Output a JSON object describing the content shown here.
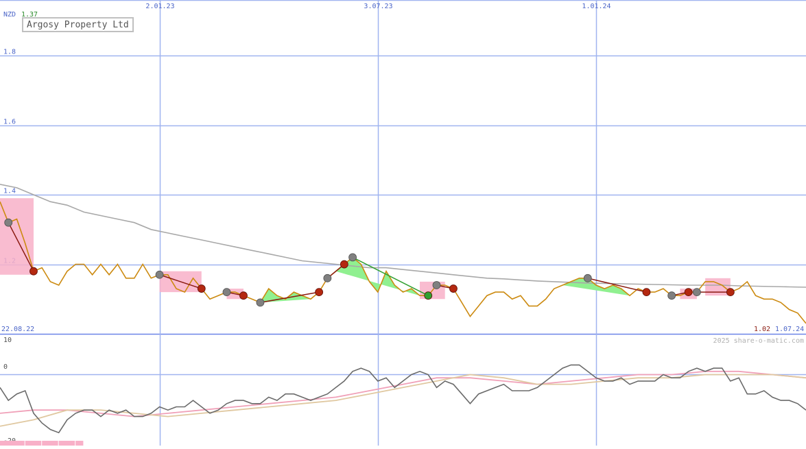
{
  "chart_data": [
    {
      "type": "line",
      "currency": "NZD",
      "last_price": "1.37",
      "title": "Argosy Property Ltd",
      "start_date": "22.08.22",
      "end_date": "1.07.24",
      "last_value_label": "1.02",
      "credit": "2025 share-o-matic.com",
      "x_ticks": [
        {
          "label": "2.01.23",
          "x": 19
        },
        {
          "label": "3.07.23",
          "x": 45
        },
        {
          "label": "1.01.24",
          "x": 71
        }
      ],
      "ylim": [
        1.0,
        1.96
      ],
      "y_ticks": [
        {
          "label": "1.8",
          "v": 1.8
        },
        {
          "label": "1.6",
          "v": 1.6
        },
        {
          "label": "1.4",
          "v": 1.4
        },
        {
          "label": "1.2",
          "v": 1.2
        }
      ],
      "grid": true,
      "xlim": [
        0,
        96
      ],
      "series": [
        {
          "color": "#cc8a10",
          "x": [
            0,
            1,
            2,
            3,
            4,
            5,
            6,
            7,
            8,
            9,
            10,
            11,
            12,
            13,
            14,
            15,
            16,
            17,
            18,
            19,
            20,
            21,
            22,
            23,
            24,
            25,
            26,
            27,
            28,
            29,
            30,
            31,
            32,
            33,
            34,
            35,
            36,
            37,
            38,
            39,
            40,
            41,
            42,
            43,
            44,
            45,
            46,
            47,
            48,
            49,
            50,
            51,
            52,
            53,
            54,
            55,
            56,
            57,
            58,
            59,
            60,
            61,
            62,
            63,
            64,
            65,
            66,
            67,
            68,
            69,
            70,
            71,
            72,
            73,
            74,
            75,
            76,
            77,
            78,
            79,
            80,
            81,
            82,
            83,
            84,
            85,
            86,
            87,
            88,
            89,
            90,
            91,
            92,
            93,
            94,
            95,
            96
          ],
          "y": [
            1.38,
            1.32,
            1.33,
            1.26,
            1.18,
            1.19,
            1.15,
            1.14,
            1.18,
            1.2,
            1.2,
            1.17,
            1.2,
            1.17,
            1.2,
            1.16,
            1.16,
            1.2,
            1.16,
            1.17,
            1.17,
            1.13,
            1.12,
            1.16,
            1.13,
            1.1,
            1.11,
            1.12,
            1.12,
            1.11,
            1.1,
            1.09,
            1.13,
            1.11,
            1.1,
            1.12,
            1.11,
            1.1,
            1.12,
            1.16,
            1.18,
            1.2,
            1.22,
            1.2,
            1.15,
            1.12,
            1.18,
            1.14,
            1.12,
            1.13,
            1.11,
            1.11,
            1.14,
            1.14,
            1.13,
            1.09,
            1.05,
            1.08,
            1.11,
            1.12,
            1.12,
            1.1,
            1.11,
            1.08,
            1.08,
            1.1,
            1.13,
            1.14,
            1.15,
            1.16,
            1.16,
            1.14,
            1.13,
            1.14,
            1.13,
            1.11,
            1.13,
            1.12,
            1.12,
            1.13,
            1.11,
            1.11,
            1.12,
            1.12,
            1.15,
            1.15,
            1.14,
            1.12,
            1.13,
            1.15,
            1.11,
            1.1,
            1.1,
            1.09,
            1.07,
            1.06,
            1.03
          ]
        },
        {
          "color": "#a8a8a8",
          "x": [
            0,
            2,
            4,
            6,
            8,
            10,
            12,
            14,
            16,
            18,
            20,
            22,
            24,
            26,
            28,
            30,
            32,
            34,
            36,
            38,
            40,
            42,
            44,
            46,
            48,
            50,
            52,
            54,
            56,
            58,
            60,
            62,
            64,
            66,
            68,
            70,
            72,
            74,
            76,
            78,
            80,
            82,
            84,
            86,
            88,
            90,
            92,
            94,
            96
          ],
          "y": [
            1.43,
            1.42,
            1.4,
            1.38,
            1.37,
            1.35,
            1.34,
            1.33,
            1.32,
            1.3,
            1.29,
            1.28,
            1.27,
            1.26,
            1.25,
            1.24,
            1.23,
            1.22,
            1.21,
            1.205,
            1.2,
            1.195,
            1.19,
            1.19,
            1.185,
            1.18,
            1.175,
            1.17,
            1.165,
            1.16,
            1.158,
            1.155,
            1.152,
            1.15,
            1.148,
            1.146,
            1.145,
            1.144,
            1.143,
            1.142,
            1.141,
            1.14,
            1.14,
            1.14,
            1.138,
            1.137,
            1.136,
            1.135,
            1.134
          ]
        }
      ]
    },
    {
      "type": "line",
      "ylim": [
        -22,
        12
      ],
      "y_ticks": [
        {
          "label": "10",
          "v": 10
        },
        {
          "label": "0",
          "v": 0
        },
        {
          "label": "-20",
          "v": -20
        }
      ],
      "series": [
        {
          "color": "#6a6a6a",
          "x": [
            0,
            1,
            2,
            3,
            4,
            5,
            6,
            7,
            8,
            9,
            10,
            11,
            12,
            13,
            14,
            15,
            16,
            17,
            18,
            19,
            20,
            21,
            22,
            23,
            24,
            25,
            26,
            27,
            28,
            29,
            30,
            31,
            32,
            33,
            34,
            35,
            36,
            37,
            38,
            39,
            40,
            41,
            42,
            43,
            44,
            45,
            46,
            47,
            48,
            49,
            50,
            51,
            52,
            53,
            54,
            55,
            56,
            57,
            58,
            59,
            60,
            61,
            62,
            63,
            64,
            65,
            66,
            67,
            68,
            69,
            70,
            71,
            72,
            73,
            74,
            75,
            76,
            77,
            78,
            79,
            80,
            81,
            82,
            83,
            84,
            85,
            86,
            87,
            88,
            89,
            90,
            91,
            92,
            93,
            94,
            95,
            96
          ],
          "y": [
            -4,
            -8,
            -6,
            -5,
            -12,
            -15,
            -17,
            -18,
            -14,
            -12,
            -11,
            -11,
            -13,
            -11,
            -12,
            -11,
            -13,
            -13,
            -12,
            -10,
            -11,
            -10,
            -10,
            -8,
            -10,
            -12,
            -11,
            -9,
            -8,
            -8,
            -9,
            -9,
            -7,
            -8,
            -6,
            -6,
            -7,
            -8,
            -7,
            -6,
            -4,
            -2,
            1,
            2,
            1,
            -2,
            -1,
            -4,
            -2,
            0,
            1,
            0,
            -4,
            -2,
            -3,
            -6,
            -9,
            -6,
            -5,
            -4,
            -3,
            -5,
            -5,
            -5,
            -4,
            -2,
            0,
            2,
            3,
            3,
            1,
            -1,
            -2,
            -2,
            -1,
            -3,
            -2,
            -2,
            -2,
            0,
            -1,
            -1,
            1,
            2,
            1,
            2,
            2,
            -2,
            -1,
            -6,
            -6,
            -5,
            -7,
            -8,
            -8,
            -9,
            -11
          ]
        },
        {
          "color": "#f0a0b8",
          "x": [
            0,
            4,
            8,
            12,
            16,
            20,
            24,
            28,
            32,
            36,
            40,
            44,
            48,
            52,
            56,
            60,
            64,
            68,
            72,
            76,
            80,
            84,
            88,
            92,
            96
          ],
          "y": [
            -12,
            -11,
            -11,
            -12,
            -13,
            -12,
            -11,
            -10,
            -9,
            -8,
            -7,
            -5,
            -3,
            -1,
            -1,
            -2,
            -3,
            -2,
            -1,
            0,
            0,
            1,
            1,
            0,
            -1
          ]
        },
        {
          "color": "#e0c8a0",
          "x": [
            0,
            4,
            8,
            12,
            16,
            20,
            24,
            28,
            32,
            36,
            40,
            44,
            48,
            52,
            56,
            60,
            64,
            68,
            72,
            76,
            80,
            84,
            88,
            92,
            96
          ],
          "y": [
            -16,
            -14,
            -11,
            -11,
            -12,
            -13,
            -12,
            -11,
            -10,
            -9,
            -8,
            -6,
            -4,
            -2,
            0,
            -1,
            -3,
            -3,
            -2,
            -1,
            -1,
            0,
            0,
            0,
            -1
          ]
        }
      ]
    }
  ],
  "colors": {
    "grid": "#a0b4f0",
    "axis_main": "#6a84e8",
    "tick_text": "#4a64c8",
    "up_fill": "#90f090",
    "down_fill": "#f8b0c8",
    "marker_down": "#b42810",
    "marker_neutral": "#808080",
    "marker_up": "#30a030",
    "last_price": "#2a8a2a"
  }
}
